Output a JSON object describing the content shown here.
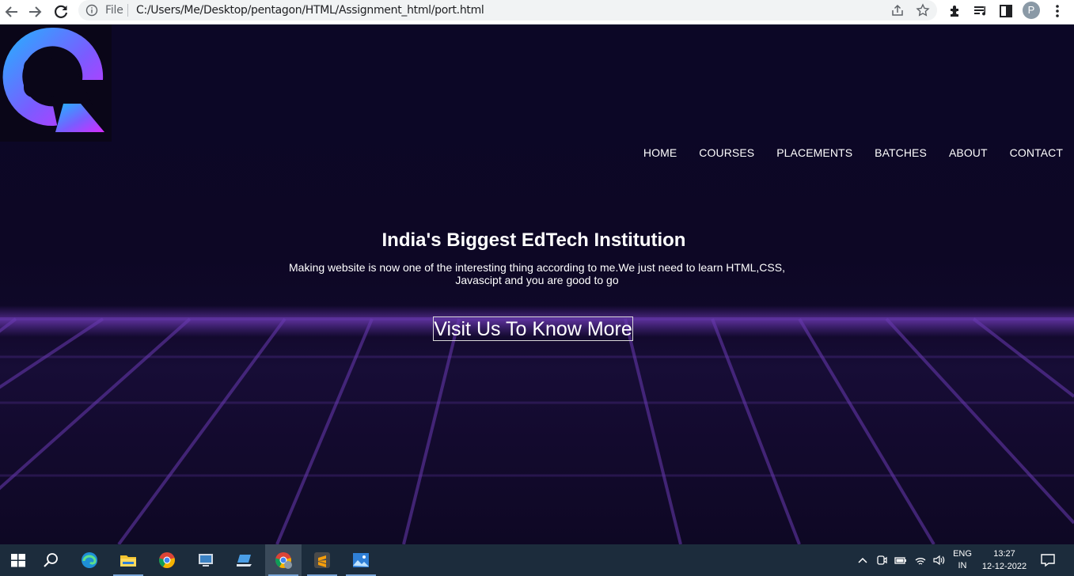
{
  "browser": {
    "scheme_label": "File",
    "url": "C:/Users/Me/Desktop/pentagon/HTML/Assignment_html/port.html",
    "profile_initial": "P"
  },
  "site": {
    "nav": [
      "HOME",
      "COURSES",
      "PLACEMENTS",
      "BATCHES",
      "ABOUT",
      "CONTACT"
    ],
    "hero_title": "India's Biggest EdTech Institution",
    "hero_text": "Making website is now one of the interesting thing according to me.We just need to learn HTML,CSS, Javascipt and you are good to go",
    "cta_label": "Visit Us To Know More",
    "colors": {
      "background": "#0c0726",
      "grid_line": "#6a3bb3",
      "logo_gradient_start": "#1fb6ff",
      "logo_gradient_end": "#d62bff"
    }
  },
  "taskbar": {
    "apps": [
      "start-icon",
      "search-icon",
      "edge-icon",
      "file-explorer-icon",
      "chrome-icon",
      "remote-desktop-icon",
      "laptop-icon",
      "chrome-profile-icon",
      "sublime-text-icon",
      "photos-icon"
    ],
    "language": "ENG",
    "region": "IN",
    "time": "13:27",
    "date": "12-12-2022"
  }
}
